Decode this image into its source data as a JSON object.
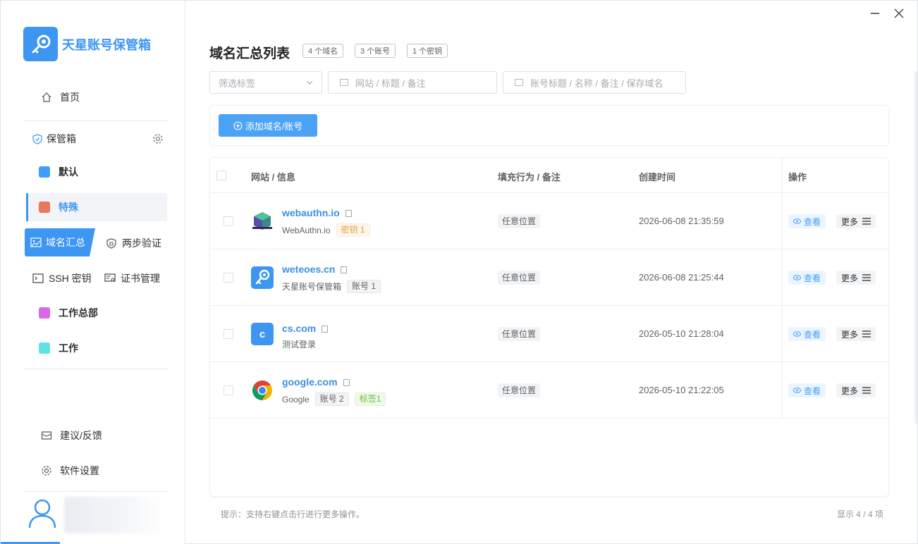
{
  "app": {
    "name": "天星账号保管箱",
    "accent": "#3d96f2"
  },
  "window": {
    "minimize_icon": "minimize-icon",
    "close_icon": "close-icon"
  },
  "sidebar": {
    "home": "首页",
    "vault_group": "保管箱",
    "vaults": [
      {
        "label": "默认",
        "color": "#409eff"
      },
      {
        "label": "特殊",
        "color": "#e8775b",
        "active": true
      }
    ],
    "tabs": {
      "domains": "域名汇总",
      "two_step": "两步验证",
      "ssh": "SSH 密钥",
      "cert": "证书管理"
    },
    "groups": [
      {
        "label": "工作总部",
        "color": "#d868e6"
      },
      {
        "label": "工作",
        "color": "#5fe3e0"
      }
    ],
    "feedback": "建议/反馈",
    "settings": "软件设置"
  },
  "main": {
    "title": "域名汇总列表",
    "badges": [
      "4 个域名",
      "3 个账号",
      "1 个密钥"
    ],
    "filters": {
      "tag_placeholder": "筛选标签",
      "site_placeholder": "网站 / 标题 / 备注",
      "account_placeholder": "账号标题 / 名称 / 备注 / 保存域名"
    },
    "add_button": "添加域名/账号",
    "table": {
      "headers": {
        "site": "网站 / 信息",
        "fill": "填充行为 / 备注",
        "created": "创建时间",
        "ops": "操作"
      },
      "rows": [
        {
          "name": "webauthn.io",
          "sub": "WebAuthn.io",
          "tags": [
            {
              "text": "密钥 1",
              "kind": "orange"
            }
          ],
          "fill": "任意位置",
          "created": "2026-06-08 21:35:59",
          "icon": "webauthn-icon"
        },
        {
          "name": "weteoes.cn",
          "sub": "天星账号保管箱",
          "tags": [
            {
              "text": "账号 1",
              "kind": "gray"
            }
          ],
          "fill": "任意位置",
          "created": "2026-06-08 21:25:44",
          "icon": "app-key-icon"
        },
        {
          "name": "cs.com",
          "sub": "测试登录",
          "tags": [],
          "fill": "任意位置",
          "created": "2026-05-10 21:28:04",
          "icon": "letter-c-icon",
          "letter": "c"
        },
        {
          "name": "google.com",
          "sub": "Google",
          "tags": [
            {
              "text": "账号 2",
              "kind": "gray"
            },
            {
              "text": "标签1",
              "kind": "green"
            }
          ],
          "fill": "任意位置",
          "created": "2026-05-10 21:22:05",
          "icon": "chrome-icon"
        }
      ],
      "view_label": "查看",
      "more_label": "更多"
    },
    "footer_hint": "提示：支持右键点击行进行更多操作。",
    "footer_count": "显示 4 / 4 项"
  }
}
